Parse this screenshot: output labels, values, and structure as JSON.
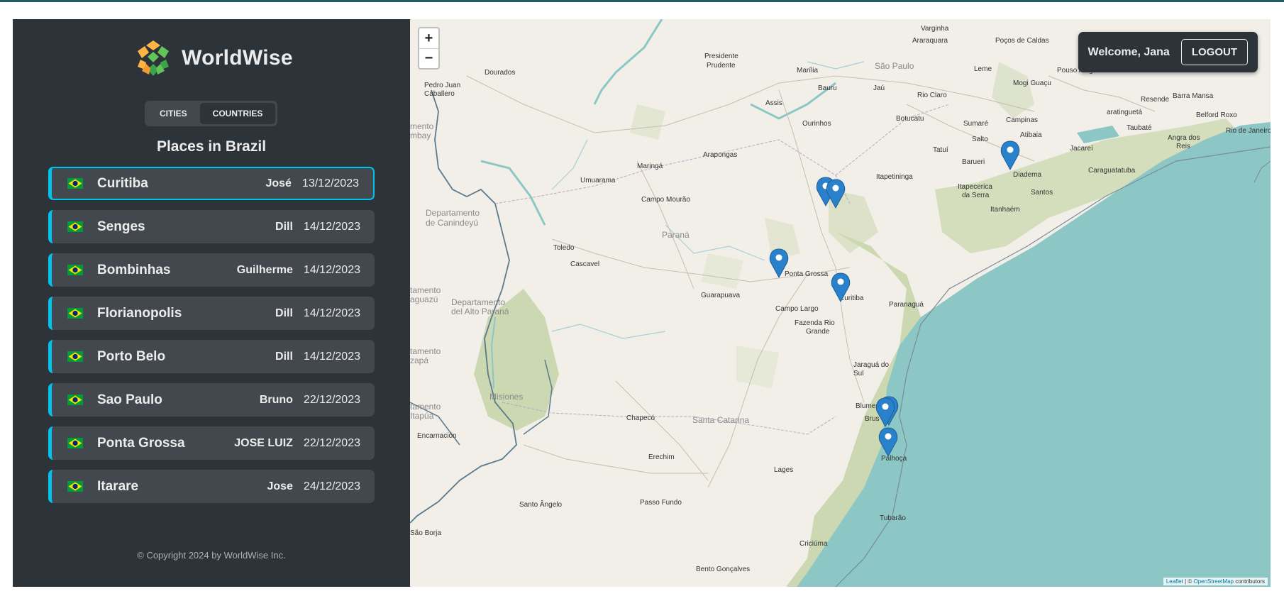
{
  "app": {
    "name": "WorldWise",
    "tabs": [
      {
        "label": "CITIES",
        "active": false
      },
      {
        "label": "COUNTRIES",
        "active": true
      }
    ],
    "places_title": "Places in Brazil",
    "copyright": "© Copyright 2024 by WorldWise Inc."
  },
  "cities": [
    {
      "name": "Curitiba",
      "person": "José",
      "date": "13/12/2023",
      "flag": "brazil-flag-icon",
      "selected": true
    },
    {
      "name": "Senges",
      "person": "Dill",
      "date": "14/12/2023",
      "flag": "brazil-flag-icon"
    },
    {
      "name": "Bombinhas",
      "person": "Guilherme",
      "date": "14/12/2023",
      "flag": "brazil-flag-icon"
    },
    {
      "name": "Florianopolis",
      "person": "Dill",
      "date": "14/12/2023",
      "flag": "brazil-flag-icon"
    },
    {
      "name": "Porto Belo",
      "person": "Dill",
      "date": "14/12/2023",
      "flag": "brazil-flag-icon"
    },
    {
      "name": "Sao Paulo",
      "person": "Bruno",
      "date": "22/12/2023",
      "flag": "brazil-flag-icon"
    },
    {
      "name": "Ponta Grossa",
      "person": "JOSE LUIZ",
      "date": "22/12/2023",
      "flag": "brazil-flag-icon"
    },
    {
      "name": "Itarare",
      "person": "Jose",
      "date": "24/12/2023",
      "flag": "brazil-flag-icon"
    }
  ],
  "user": {
    "welcome": "Welcome, Jana",
    "logout_label": "LOGOUT"
  },
  "map": {
    "zoom_in": "+",
    "zoom_out": "−",
    "attribution_leaflet": "Leaflet",
    "attribution_sep": " | © ",
    "attribution_osm": "OpenStreetMap",
    "attribution_tail": " contributors",
    "labels": {
      "varginha": "Varginha",
      "araraquara": "Araraquara",
      "pocos": "Poços de Caldas",
      "presidente": "Presidente",
      "prudente": "Prudente",
      "marilia": "Marília",
      "sao_paulo_state": "São Paulo",
      "dourados": "Dourados",
      "pedro_juan": "Pedro Juan",
      "caballero": "Caballero",
      "bauru": "Bauru",
      "jau": "Jaú",
      "rio_claro": "Rio Claro",
      "leme": "Leme",
      "mogi": "Mogi Guaçu",
      "pouso": "Pouso Aleg",
      "barra_mansa": "Barra Mansa",
      "resende": "Resende",
      "belford": "Belford Roxo",
      "assis": "Assis",
      "ourinhos": "Ourinhos",
      "botucatu": "Botucatu",
      "sumare": "Sumaré",
      "campinas": "Campinas",
      "aratinguet": "aratinguetá",
      "taubate": "Taubaté",
      "angra1": "Angra dos",
      "angra2": "Reis",
      "rio": "Rio de Janeiro",
      "atibaia": "Atibaia",
      "salto": "Salto",
      "jacarei": "Jacareí",
      "tatui": "Tatuí",
      "barueri": "Barueri",
      "diadema": "Diadema",
      "caraguatatuba": "Caraguatatuba",
      "maringa": "Maringá",
      "arapongas": "Arapongas",
      "umuarama": "Umuarama",
      "itapetininga": "Itapetininga",
      "itapecerica1": "Itapecerica",
      "itapecerica2": "da Serra",
      "santos": "Santos",
      "campo_mourao": "Campo Mourão",
      "itanhaem": "Itanhaém",
      "depto1": "Departamento",
      "depto2": "de Canindeyú",
      "parana": "Paraná",
      "toledo": "Toledo",
      "cascavel": "Cascavel",
      "ponta_grossa": "Ponta Grossa",
      "guarapuava": "Guarapuava",
      "curitiba": "Curitiba",
      "paranagua": "Paranaguá",
      "campo_largo": "Campo Largo",
      "depto_alto1": "Departamento",
      "depto_alto2": "del Alto Paraná",
      "fazenda1": "Fazenda Rio",
      "fazenda2": "Grande",
      "jaragua1": "Jaraguá do",
      "jaragua2": "Sul",
      "misiones": "Misiones",
      "blumenau": "Blumen",
      "brusque": "Brus",
      "chapeco": "Chapecó",
      "santa_catarina": "Santa Catarina",
      "encarnacion": "Encarnación",
      "erechim": "Erechim",
      "palhoca": "Palhoça",
      "lages": "Lages",
      "santo_angelo": "Santo Ângelo",
      "passo_fundo": "Passo Fundo",
      "tubarao": "Tubarão",
      "sao_borja": "São Borja",
      "criciuma": "Criciúma",
      "bento": "Bento Gonçalves",
      "edge1": "mbay",
      "edge2": "tamento",
      "edge3": "aguazú",
      "edge4": "tamento",
      "edge5": "zapá",
      "edge6": "tamento",
      "edge7": "Itapúa",
      "edge8": "mento"
    },
    "markers": [
      "map-marker-sao-paulo",
      "map-marker-senges",
      "map-marker-itarare",
      "map-marker-ponta-grossa",
      "map-marker-curitiba",
      "map-marker-bombinhas",
      "map-marker-porto-belo",
      "map-marker-florianopolis"
    ],
    "colors": {
      "water": "#8cc7c5",
      "land": "#f2efe9",
      "forest": "#b7c99c",
      "border": "#5b7a8c",
      "accent": "#00c3ee",
      "marker": "#2a81cb"
    }
  }
}
